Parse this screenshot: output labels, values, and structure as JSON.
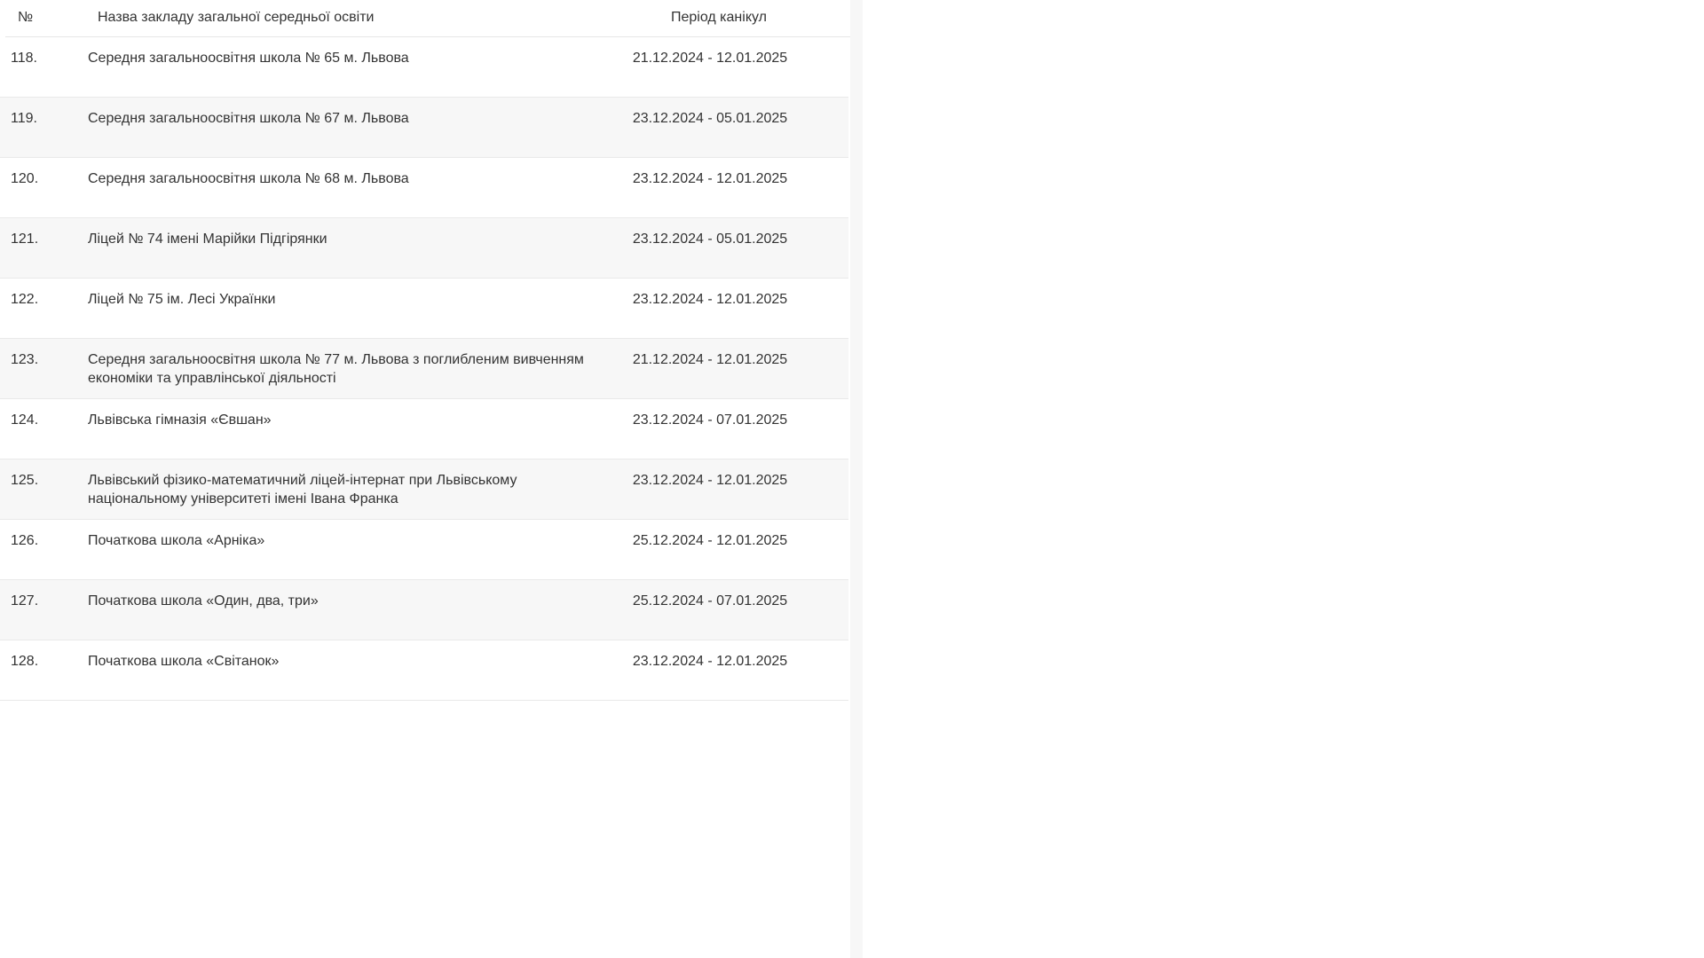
{
  "table": {
    "headers": {
      "num": "№",
      "name": "Назва закладу загальної середньої освіти",
      "period": "Період канікул"
    },
    "rows": [
      {
        "num": "118.",
        "name": "Середня загальноосвітня школа № 65 м. Львова",
        "period": "21.12.2024 - 12.01.2025"
      },
      {
        "num": "119.",
        "name": "Середня загальноосвітня школа № 67 м. Львова",
        "period": "23.12.2024 - 05.01.2025"
      },
      {
        "num": "120.",
        "name": "Середня загальноосвітня школа № 68 м. Львова",
        "period": "23.12.2024 - 12.01.2025"
      },
      {
        "num": "121.",
        "name": "Ліцей № 74 імені Марійки Підгірянки",
        "period": "23.12.2024 - 05.01.2025"
      },
      {
        "num": "122.",
        "name": "Ліцей № 75 ім. Лесі Українки",
        "period": "23.12.2024 - 12.01.2025"
      },
      {
        "num": "123.",
        "name": "Середня загальноосвітня школа № 77 м. Львова з поглибленим вивченням економіки та управлінської діяльності",
        "period": "21.12.2024 - 12.01.2025"
      },
      {
        "num": "124.",
        "name": "Львівська гімназія «Євшан»",
        "period": "23.12.2024 - 07.01.2025"
      },
      {
        "num": "125.",
        "name": "Львівський фізико-математичний ліцей-інтернат при Львівському національному університеті імені Івана Франка",
        "period": "23.12.2024 - 12.01.2025"
      },
      {
        "num": "126.",
        "name": "Початкова школа «Арніка»",
        "period": "25.12.2024 - 12.01.2025"
      },
      {
        "num": "127.",
        "name": "Початкова школа «Один, два, три»",
        "period": "25.12.2024 - 07.01.2025"
      },
      {
        "num": "128.",
        "name": "Початкова школа «Світанок»",
        "period": "23.12.2024 - 12.01.2025"
      }
    ]
  }
}
